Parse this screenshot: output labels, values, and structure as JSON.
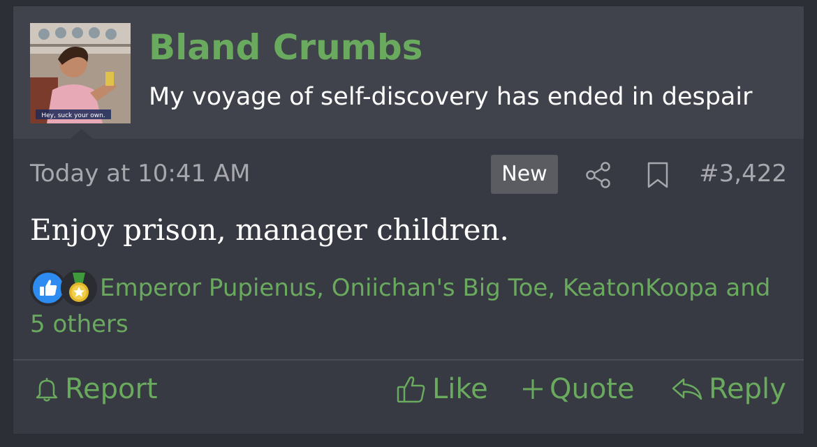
{
  "user": {
    "name": "Bland Crumbs",
    "title": "My voyage of self-discovery has ended in despair",
    "avatar_caption": "Hey, suck your own."
  },
  "meta": {
    "timestamp": "Today at 10:41 AM",
    "new_badge": "New",
    "post_number": "#3,422"
  },
  "message": {
    "text": "Enjoy prison, manager children."
  },
  "reactions": {
    "icons": [
      "like-icon",
      "medal-icon"
    ],
    "users_text": "Emperor Pupienus, Oniichan's Big Toe, KeatonKoopa and 5 others"
  },
  "actions": {
    "report": "Report",
    "like": "Like",
    "quote": "Quote",
    "reply": "Reply"
  },
  "colors": {
    "accent": "#6aaa5e",
    "background": "#373a42",
    "header": "#40434b",
    "muted_text": "#a6a8ad"
  }
}
